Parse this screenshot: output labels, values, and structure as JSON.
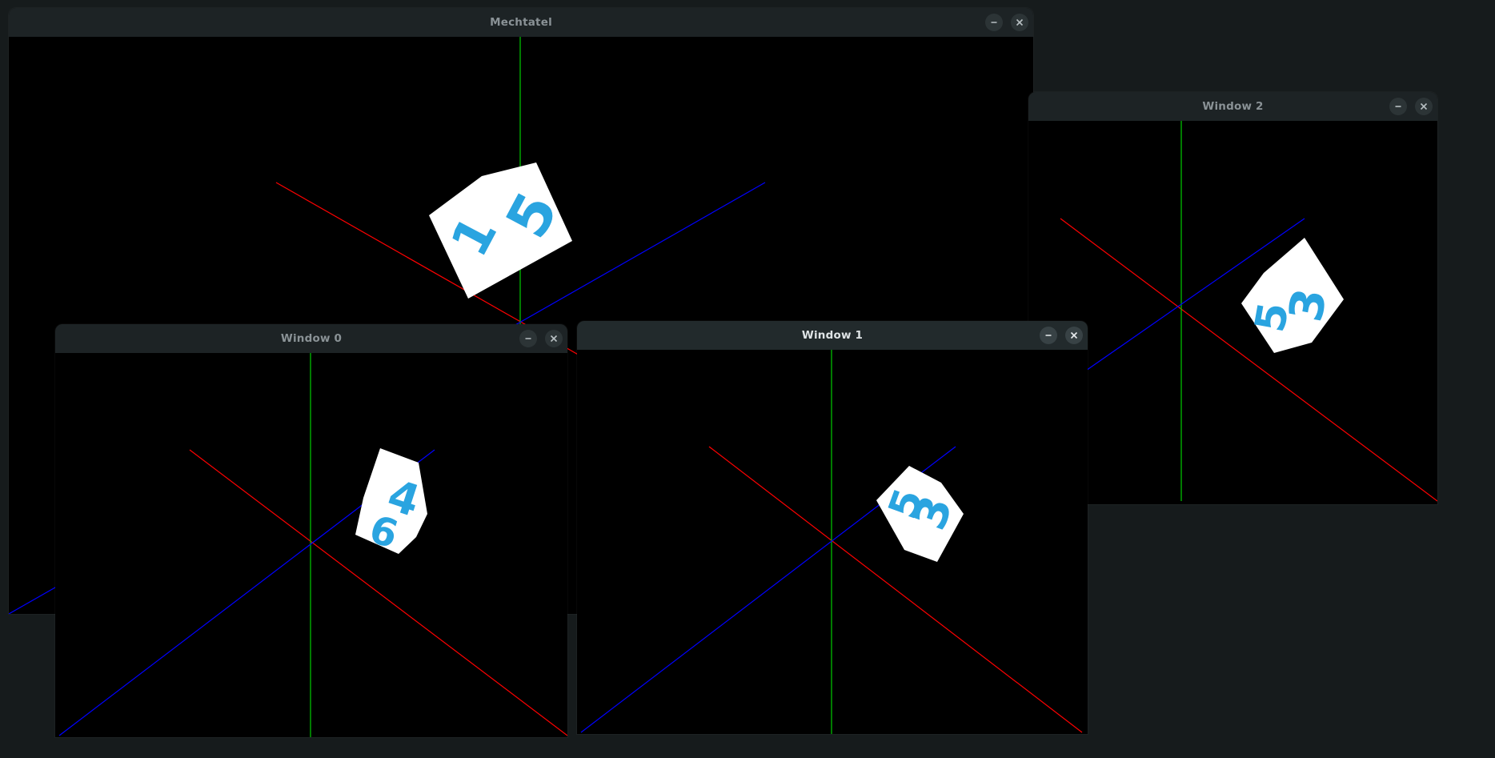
{
  "desktop": {
    "background": "#161b1c"
  },
  "windows": {
    "main": {
      "title": "Mechtatel"
    },
    "window2": {
      "title": "Window 2"
    },
    "window0": {
      "title": "Window 0"
    },
    "window1": {
      "title": "Window 1"
    }
  },
  "controls": {
    "minimize_icon": "minimize-icon",
    "close_icon": "close-icon"
  },
  "colors": {
    "x_axis": "#ff0000",
    "y_axis": "#00cc00",
    "z_axis": "#0000ff",
    "cube_face": "#ffffff",
    "digit_ink": "#2aa4e0"
  },
  "scene_digits": {
    "main": [
      "1",
      "5"
    ],
    "window2": [
      "5",
      "3"
    ],
    "window0": [
      "4",
      "6"
    ],
    "window1": [
      "5",
      "3"
    ]
  }
}
